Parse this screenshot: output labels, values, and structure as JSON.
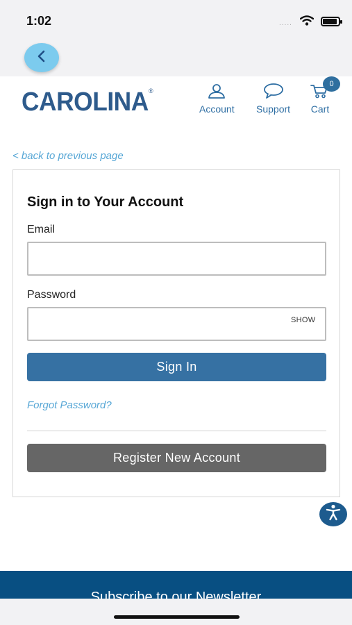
{
  "status_bar": {
    "time": "1:02",
    "signal_dots": "....."
  },
  "header": {
    "logo_text": "CAROLINA",
    "logo_reg": "®",
    "nav": {
      "account_label": "Account",
      "support_label": "Support",
      "cart_label": "Cart",
      "cart_count": "0"
    },
    "icons": {
      "back": "chevron-left-icon",
      "account": "person-icon",
      "support": "chat-bubble-icon",
      "cart": "cart-icon"
    }
  },
  "back_link": "< back to previous page",
  "signin": {
    "title": "Sign in to Your Account",
    "email_label": "Email",
    "email_value": "",
    "password_label": "Password",
    "password_value": "",
    "show_label": "SHOW",
    "signin_button": "Sign In",
    "forgot_password": "Forgot Password?",
    "register_button": "Register New Account"
  },
  "accessibility_icon": "accessibility-icon",
  "footer": {
    "newsletter_text": "Subscribe to our Newsletter"
  },
  "colors": {
    "brand_blue": "#2e5b8c",
    "primary_button": "#3671a3",
    "secondary_button": "#666666",
    "link": "#57a7d6",
    "footer_bg": "#084f82",
    "back_button": "#7ccbee"
  }
}
